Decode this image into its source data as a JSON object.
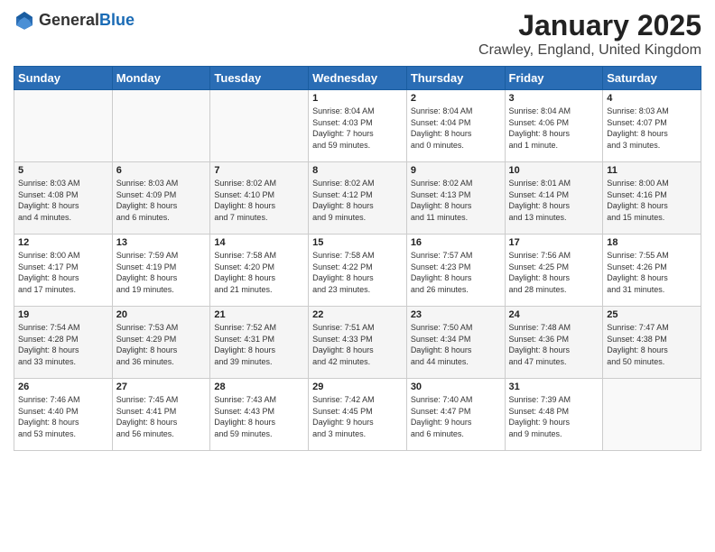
{
  "header": {
    "logo_general": "General",
    "logo_blue": "Blue",
    "title": "January 2025",
    "subtitle": "Crawley, England, United Kingdom"
  },
  "days_of_week": [
    "Sunday",
    "Monday",
    "Tuesday",
    "Wednesday",
    "Thursday",
    "Friday",
    "Saturday"
  ],
  "weeks": [
    [
      {
        "day": "",
        "info": ""
      },
      {
        "day": "",
        "info": ""
      },
      {
        "day": "",
        "info": ""
      },
      {
        "day": "1",
        "info": "Sunrise: 8:04 AM\nSunset: 4:03 PM\nDaylight: 7 hours\nand 59 minutes."
      },
      {
        "day": "2",
        "info": "Sunrise: 8:04 AM\nSunset: 4:04 PM\nDaylight: 8 hours\nand 0 minutes."
      },
      {
        "day": "3",
        "info": "Sunrise: 8:04 AM\nSunset: 4:06 PM\nDaylight: 8 hours\nand 1 minute."
      },
      {
        "day": "4",
        "info": "Sunrise: 8:03 AM\nSunset: 4:07 PM\nDaylight: 8 hours\nand 3 minutes."
      }
    ],
    [
      {
        "day": "5",
        "info": "Sunrise: 8:03 AM\nSunset: 4:08 PM\nDaylight: 8 hours\nand 4 minutes."
      },
      {
        "day": "6",
        "info": "Sunrise: 8:03 AM\nSunset: 4:09 PM\nDaylight: 8 hours\nand 6 minutes."
      },
      {
        "day": "7",
        "info": "Sunrise: 8:02 AM\nSunset: 4:10 PM\nDaylight: 8 hours\nand 7 minutes."
      },
      {
        "day": "8",
        "info": "Sunrise: 8:02 AM\nSunset: 4:12 PM\nDaylight: 8 hours\nand 9 minutes."
      },
      {
        "day": "9",
        "info": "Sunrise: 8:02 AM\nSunset: 4:13 PM\nDaylight: 8 hours\nand 11 minutes."
      },
      {
        "day": "10",
        "info": "Sunrise: 8:01 AM\nSunset: 4:14 PM\nDaylight: 8 hours\nand 13 minutes."
      },
      {
        "day": "11",
        "info": "Sunrise: 8:00 AM\nSunset: 4:16 PM\nDaylight: 8 hours\nand 15 minutes."
      }
    ],
    [
      {
        "day": "12",
        "info": "Sunrise: 8:00 AM\nSunset: 4:17 PM\nDaylight: 8 hours\nand 17 minutes."
      },
      {
        "day": "13",
        "info": "Sunrise: 7:59 AM\nSunset: 4:19 PM\nDaylight: 8 hours\nand 19 minutes."
      },
      {
        "day": "14",
        "info": "Sunrise: 7:58 AM\nSunset: 4:20 PM\nDaylight: 8 hours\nand 21 minutes."
      },
      {
        "day": "15",
        "info": "Sunrise: 7:58 AM\nSunset: 4:22 PM\nDaylight: 8 hours\nand 23 minutes."
      },
      {
        "day": "16",
        "info": "Sunrise: 7:57 AM\nSunset: 4:23 PM\nDaylight: 8 hours\nand 26 minutes."
      },
      {
        "day": "17",
        "info": "Sunrise: 7:56 AM\nSunset: 4:25 PM\nDaylight: 8 hours\nand 28 minutes."
      },
      {
        "day": "18",
        "info": "Sunrise: 7:55 AM\nSunset: 4:26 PM\nDaylight: 8 hours\nand 31 minutes."
      }
    ],
    [
      {
        "day": "19",
        "info": "Sunrise: 7:54 AM\nSunset: 4:28 PM\nDaylight: 8 hours\nand 33 minutes."
      },
      {
        "day": "20",
        "info": "Sunrise: 7:53 AM\nSunset: 4:29 PM\nDaylight: 8 hours\nand 36 minutes."
      },
      {
        "day": "21",
        "info": "Sunrise: 7:52 AM\nSunset: 4:31 PM\nDaylight: 8 hours\nand 39 minutes."
      },
      {
        "day": "22",
        "info": "Sunrise: 7:51 AM\nSunset: 4:33 PM\nDaylight: 8 hours\nand 42 minutes."
      },
      {
        "day": "23",
        "info": "Sunrise: 7:50 AM\nSunset: 4:34 PM\nDaylight: 8 hours\nand 44 minutes."
      },
      {
        "day": "24",
        "info": "Sunrise: 7:48 AM\nSunset: 4:36 PM\nDaylight: 8 hours\nand 47 minutes."
      },
      {
        "day": "25",
        "info": "Sunrise: 7:47 AM\nSunset: 4:38 PM\nDaylight: 8 hours\nand 50 minutes."
      }
    ],
    [
      {
        "day": "26",
        "info": "Sunrise: 7:46 AM\nSunset: 4:40 PM\nDaylight: 8 hours\nand 53 minutes."
      },
      {
        "day": "27",
        "info": "Sunrise: 7:45 AM\nSunset: 4:41 PM\nDaylight: 8 hours\nand 56 minutes."
      },
      {
        "day": "28",
        "info": "Sunrise: 7:43 AM\nSunset: 4:43 PM\nDaylight: 8 hours\nand 59 minutes."
      },
      {
        "day": "29",
        "info": "Sunrise: 7:42 AM\nSunset: 4:45 PM\nDaylight: 9 hours\nand 3 minutes."
      },
      {
        "day": "30",
        "info": "Sunrise: 7:40 AM\nSunset: 4:47 PM\nDaylight: 9 hours\nand 6 minutes."
      },
      {
        "day": "31",
        "info": "Sunrise: 7:39 AM\nSunset: 4:48 PM\nDaylight: 9 hours\nand 9 minutes."
      },
      {
        "day": "",
        "info": ""
      }
    ]
  ]
}
